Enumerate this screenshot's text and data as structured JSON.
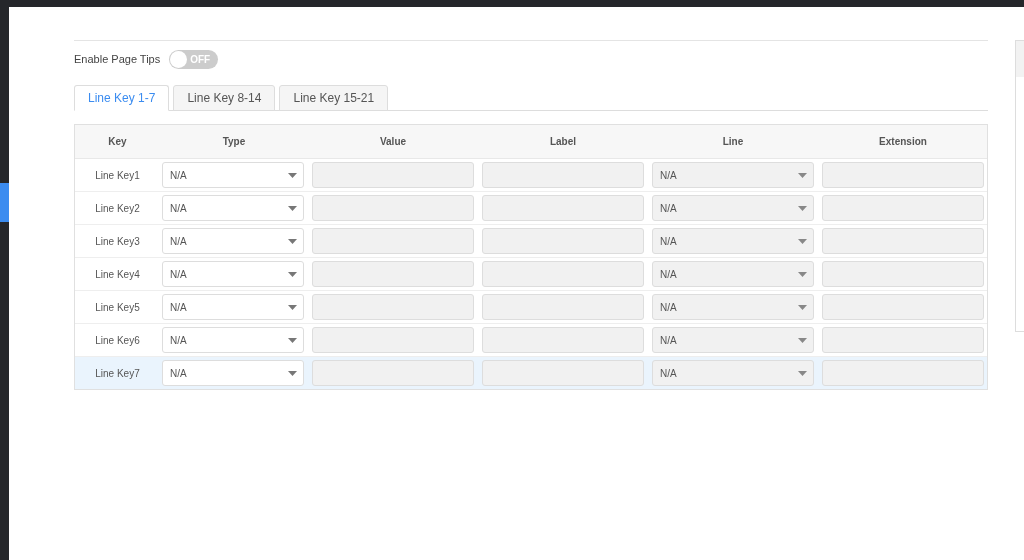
{
  "page_tips": {
    "label": "Enable Page Tips",
    "on": false,
    "toggle_text": "OFF"
  },
  "tabs": [
    {
      "label": "Line Key 1-7",
      "selected": true
    },
    {
      "label": "Line Key 8-14",
      "selected": false
    },
    {
      "label": "Line Key 15-21",
      "selected": false
    }
  ],
  "table": {
    "columns": [
      "Key",
      "Type",
      "Value",
      "Label",
      "Line",
      "Extension"
    ],
    "rows": [
      {
        "key": "Line Key1",
        "type": "N/A",
        "line": "N/A",
        "highlighted": false
      },
      {
        "key": "Line Key2",
        "type": "N/A",
        "line": "N/A",
        "highlighted": false
      },
      {
        "key": "Line Key3",
        "type": "N/A",
        "line": "N/A",
        "highlighted": false
      },
      {
        "key": "Line Key4",
        "type": "N/A",
        "line": "N/A",
        "highlighted": false
      },
      {
        "key": "Line Key5",
        "type": "N/A",
        "line": "N/A",
        "highlighted": false
      },
      {
        "key": "Line Key6",
        "type": "N/A",
        "line": "N/A",
        "highlighted": false
      },
      {
        "key": "Line Key7",
        "type": "N/A",
        "line": "N/A",
        "highlighted": true
      }
    ]
  }
}
